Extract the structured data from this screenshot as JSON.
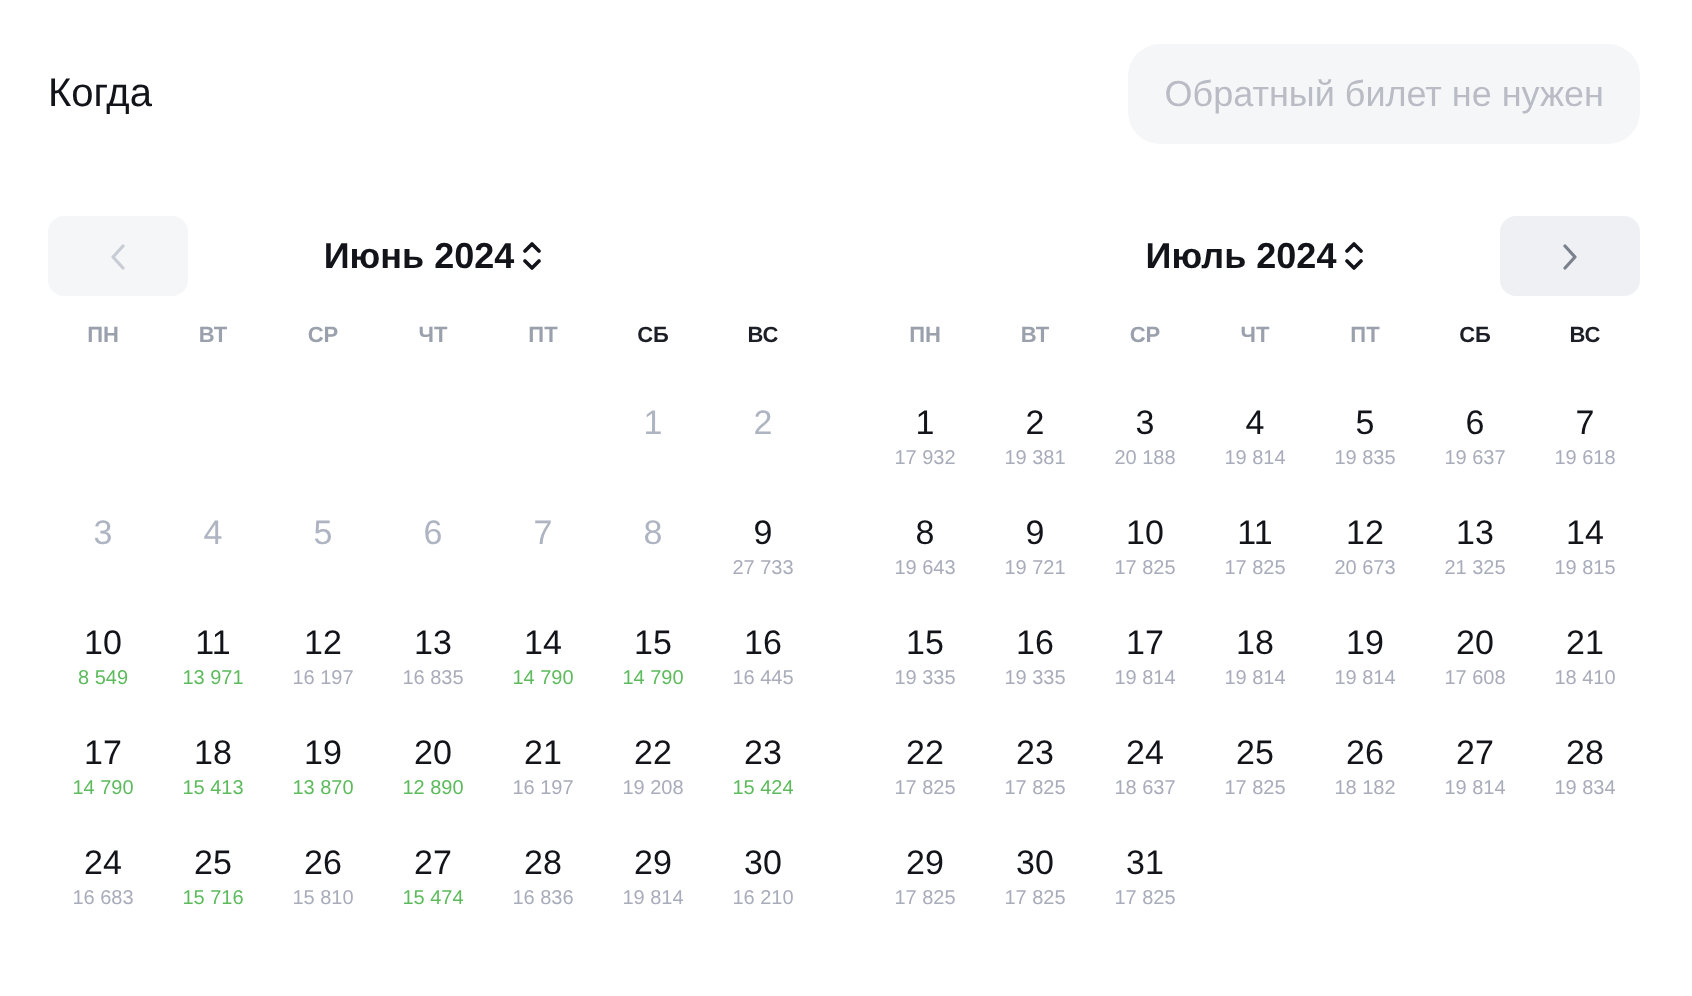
{
  "title": "Когда",
  "return_toggle": {
    "label": "Обратный билет не нужен",
    "selected": false
  },
  "months": [
    {
      "title": "Июнь 2024",
      "nav": {
        "kind": "prev",
        "disabled": true
      },
      "weekdays": [
        {
          "label": "ПН",
          "weekend": false
        },
        {
          "label": "ВТ",
          "weekend": false
        },
        {
          "label": "СР",
          "weekend": false
        },
        {
          "label": "ЧТ",
          "weekend": false
        },
        {
          "label": "ПТ",
          "weekend": false
        },
        {
          "label": "СБ",
          "weekend": true
        },
        {
          "label": "ВС",
          "weekend": true
        }
      ],
      "weeks": [
        [
          {
            "kind": "blank"
          },
          {
            "kind": "blank"
          },
          {
            "kind": "blank"
          },
          {
            "kind": "blank"
          },
          {
            "kind": "blank"
          },
          {
            "kind": "day",
            "day": "1",
            "disabled": true
          },
          {
            "kind": "day",
            "day": "2",
            "disabled": true
          }
        ],
        [
          {
            "kind": "day",
            "day": "3",
            "disabled": true
          },
          {
            "kind": "day",
            "day": "4",
            "disabled": true
          },
          {
            "kind": "day",
            "day": "5",
            "disabled": true
          },
          {
            "kind": "day",
            "day": "6",
            "disabled": true
          },
          {
            "kind": "day",
            "day": "7",
            "disabled": true
          },
          {
            "kind": "day",
            "day": "8",
            "disabled": true
          },
          {
            "kind": "day",
            "day": "9",
            "disabled": false,
            "price": "27 733",
            "cheap": false
          }
        ],
        [
          {
            "kind": "day",
            "day": "10",
            "disabled": false,
            "price": "8 549",
            "cheap": true
          },
          {
            "kind": "day",
            "day": "11",
            "disabled": false,
            "price": "13 971",
            "cheap": true
          },
          {
            "kind": "day",
            "day": "12",
            "disabled": false,
            "price": "16 197",
            "cheap": false
          },
          {
            "kind": "day",
            "day": "13",
            "disabled": false,
            "price": "16 835",
            "cheap": false
          },
          {
            "kind": "day",
            "day": "14",
            "disabled": false,
            "price": "14 790",
            "cheap": true
          },
          {
            "kind": "day",
            "day": "15",
            "disabled": false,
            "price": "14 790",
            "cheap": true
          },
          {
            "kind": "day",
            "day": "16",
            "disabled": false,
            "price": "16 445",
            "cheap": false
          }
        ],
        [
          {
            "kind": "day",
            "day": "17",
            "disabled": false,
            "price": "14 790",
            "cheap": true
          },
          {
            "kind": "day",
            "day": "18",
            "disabled": false,
            "price": "15 413",
            "cheap": true
          },
          {
            "kind": "day",
            "day": "19",
            "disabled": false,
            "price": "13 870",
            "cheap": true
          },
          {
            "kind": "day",
            "day": "20",
            "disabled": false,
            "price": "12 890",
            "cheap": true
          },
          {
            "kind": "day",
            "day": "21",
            "disabled": false,
            "price": "16 197",
            "cheap": false
          },
          {
            "kind": "day",
            "day": "22",
            "disabled": false,
            "price": "19 208",
            "cheap": false
          },
          {
            "kind": "day",
            "day": "23",
            "disabled": false,
            "price": "15 424",
            "cheap": true
          }
        ],
        [
          {
            "kind": "day",
            "day": "24",
            "disabled": false,
            "price": "16 683",
            "cheap": false
          },
          {
            "kind": "day",
            "day": "25",
            "disabled": false,
            "price": "15 716",
            "cheap": true
          },
          {
            "kind": "day",
            "day": "26",
            "disabled": false,
            "price": "15 810",
            "cheap": false
          },
          {
            "kind": "day",
            "day": "27",
            "disabled": false,
            "price": "15 474",
            "cheap": true
          },
          {
            "kind": "day",
            "day": "28",
            "disabled": false,
            "price": "16 836",
            "cheap": false
          },
          {
            "kind": "day",
            "day": "29",
            "disabled": false,
            "price": "19 814",
            "cheap": false
          },
          {
            "kind": "day",
            "day": "30",
            "disabled": false,
            "price": "16 210",
            "cheap": false
          }
        ]
      ]
    },
    {
      "title": "Июль 2024",
      "nav": {
        "kind": "next",
        "disabled": false
      },
      "weekdays": [
        {
          "label": "ПН",
          "weekend": false
        },
        {
          "label": "ВТ",
          "weekend": false
        },
        {
          "label": "СР",
          "weekend": false
        },
        {
          "label": "ЧТ",
          "weekend": false
        },
        {
          "label": "ПТ",
          "weekend": false
        },
        {
          "label": "СБ",
          "weekend": true
        },
        {
          "label": "ВС",
          "weekend": true
        }
      ],
      "weeks": [
        [
          {
            "kind": "day",
            "day": "1",
            "disabled": false,
            "price": "17 932",
            "cheap": false
          },
          {
            "kind": "day",
            "day": "2",
            "disabled": false,
            "price": "19 381",
            "cheap": false
          },
          {
            "kind": "day",
            "day": "3",
            "disabled": false,
            "price": "20 188",
            "cheap": false
          },
          {
            "kind": "day",
            "day": "4",
            "disabled": false,
            "price": "19 814",
            "cheap": false
          },
          {
            "kind": "day",
            "day": "5",
            "disabled": false,
            "price": "19 835",
            "cheap": false
          },
          {
            "kind": "day",
            "day": "6",
            "disabled": false,
            "price": "19 637",
            "cheap": false
          },
          {
            "kind": "day",
            "day": "7",
            "disabled": false,
            "price": "19 618",
            "cheap": false
          }
        ],
        [
          {
            "kind": "day",
            "day": "8",
            "disabled": false,
            "price": "19 643",
            "cheap": false
          },
          {
            "kind": "day",
            "day": "9",
            "disabled": false,
            "price": "19 721",
            "cheap": false
          },
          {
            "kind": "day",
            "day": "10",
            "disabled": false,
            "price": "17 825",
            "cheap": false
          },
          {
            "kind": "day",
            "day": "11",
            "disabled": false,
            "price": "17 825",
            "cheap": false
          },
          {
            "kind": "day",
            "day": "12",
            "disabled": false,
            "price": "20 673",
            "cheap": false
          },
          {
            "kind": "day",
            "day": "13",
            "disabled": false,
            "price": "21 325",
            "cheap": false
          },
          {
            "kind": "day",
            "day": "14",
            "disabled": false,
            "price": "19 815",
            "cheap": false
          }
        ],
        [
          {
            "kind": "day",
            "day": "15",
            "disabled": false,
            "price": "19 335",
            "cheap": false
          },
          {
            "kind": "day",
            "day": "16",
            "disabled": false,
            "price": "19 335",
            "cheap": false
          },
          {
            "kind": "day",
            "day": "17",
            "disabled": false,
            "price": "19 814",
            "cheap": false
          },
          {
            "kind": "day",
            "day": "18",
            "disabled": false,
            "price": "19 814",
            "cheap": false
          },
          {
            "kind": "day",
            "day": "19",
            "disabled": false,
            "price": "19 814",
            "cheap": false
          },
          {
            "kind": "day",
            "day": "20",
            "disabled": false,
            "price": "17 608",
            "cheap": false
          },
          {
            "kind": "day",
            "day": "21",
            "disabled": false,
            "price": "18 410",
            "cheap": false
          }
        ],
        [
          {
            "kind": "day",
            "day": "22",
            "disabled": false,
            "price": "17 825",
            "cheap": false
          },
          {
            "kind": "day",
            "day": "23",
            "disabled": false,
            "price": "17 825",
            "cheap": false
          },
          {
            "kind": "day",
            "day": "24",
            "disabled": false,
            "price": "18 637",
            "cheap": false
          },
          {
            "kind": "day",
            "day": "25",
            "disabled": false,
            "price": "17 825",
            "cheap": false
          },
          {
            "kind": "day",
            "day": "26",
            "disabled": false,
            "price": "18 182",
            "cheap": false
          },
          {
            "kind": "day",
            "day": "27",
            "disabled": false,
            "price": "19 814",
            "cheap": false
          },
          {
            "kind": "day",
            "day": "28",
            "disabled": false,
            "price": "19 834",
            "cheap": false
          }
        ],
        [
          {
            "kind": "day",
            "day": "29",
            "disabled": false,
            "price": "17 825",
            "cheap": false
          },
          {
            "kind": "day",
            "day": "30",
            "disabled": false,
            "price": "17 825",
            "cheap": false
          },
          {
            "kind": "day",
            "day": "31",
            "disabled": false,
            "price": "17 825",
            "cheap": false
          },
          {
            "kind": "blank"
          },
          {
            "kind": "blank"
          },
          {
            "kind": "blank"
          },
          {
            "kind": "blank"
          }
        ]
      ]
    }
  ]
}
